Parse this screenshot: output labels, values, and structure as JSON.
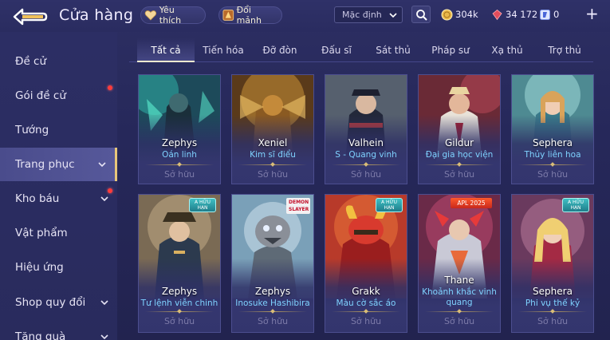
{
  "header": {
    "title": "Cửa hàng",
    "favorites_label": "Yêu thích",
    "fragments_label": "Đổi mảnh",
    "sort_value": "Mặc định",
    "currencies": {
      "gold": "304k",
      "ruby": "34 172",
      "voucher": "0"
    },
    "plus": "+"
  },
  "sidebar": {
    "items": [
      {
        "label": "Đề cử"
      },
      {
        "label": "Gói đề cử"
      },
      {
        "label": "Tướng"
      },
      {
        "label": "Trang phục"
      },
      {
        "label": "Kho báu"
      },
      {
        "label": "Vật phẩm"
      },
      {
        "label": "Hiệu ứng"
      },
      {
        "label": "Shop quy đổi"
      },
      {
        "label": "Tặng quà"
      }
    ]
  },
  "tabs": [
    "Tất cả",
    "Tiến hóa",
    "Đỡ đòn",
    "Đấu sĩ",
    "Sát thủ",
    "Pháp sư",
    "Xạ thủ",
    "Trợ thủ"
  ],
  "cards": [
    {
      "hero": "Zephys",
      "skin": "Oán linh",
      "status": "Sở hữu"
    },
    {
      "hero": "Xeniel",
      "skin": "Kim sĩ điểu",
      "status": "Sở hữu"
    },
    {
      "hero": "Valhein",
      "skin": "S - Quang vinh",
      "status": "Sở hữu"
    },
    {
      "hero": "Gildur",
      "skin": "Đại gia học viện",
      "status": "Sở hữu"
    },
    {
      "hero": "Sephera",
      "skin": "Thủy liên hoa",
      "status": "Sở hữu"
    },
    {
      "hero": "Zephys",
      "skin": "Tư lệnh viễn chinh",
      "status": "Sở hữu",
      "badge": "A HỮU HẠN"
    },
    {
      "hero": "Zephys",
      "skin": "Inosuke Hashibira",
      "status": "Sở hữu",
      "badge": "DEMON SLAYER"
    },
    {
      "hero": "Grakk",
      "skin": "Màu cờ sắc áo",
      "status": "Sở hữu",
      "badge": "A HỮU HẠN"
    },
    {
      "hero": "Thane",
      "skin": "Khoảnh khắc vinh quang",
      "status": "Sở hữu",
      "badge": "APL 2025"
    },
    {
      "hero": "Sephera",
      "skin": "Phi vụ thế kỷ",
      "status": "Sở hữu",
      "badge": "A HỮU HẠN"
    }
  ]
}
